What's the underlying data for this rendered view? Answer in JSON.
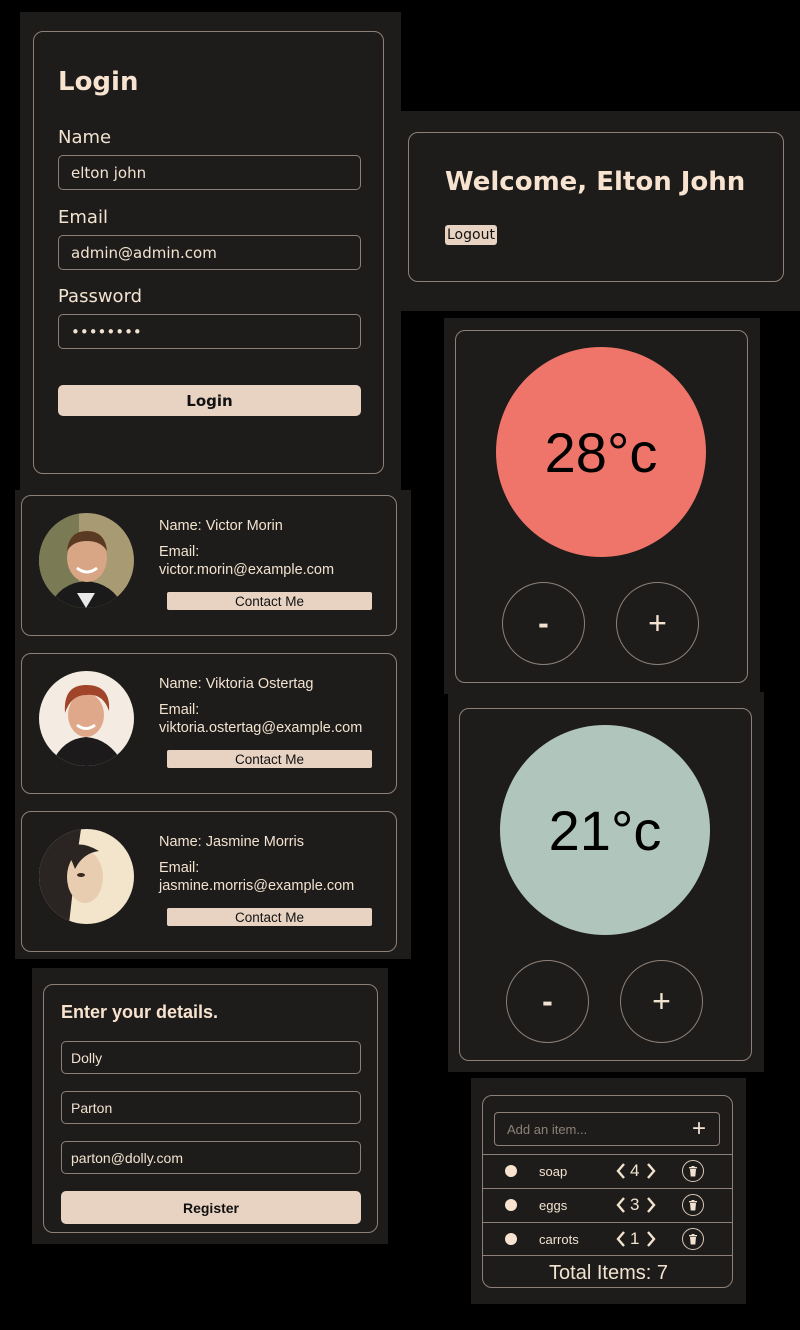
{
  "login": {
    "title": "Login",
    "name_label": "Name",
    "name_value": "elton john",
    "email_label": "Email",
    "email_value": "admin@admin.com",
    "password_label": "Password",
    "password_value": "password",
    "submit_label": "Login"
  },
  "welcome": {
    "title": "Welcome, Elton John",
    "logout_label": "Logout"
  },
  "thermostats": [
    {
      "value": "28°c",
      "color": "#ef746a",
      "minus_label": "-",
      "plus_label": "+"
    },
    {
      "value": "21°c",
      "color": "#b0c5bc",
      "minus_label": "-",
      "plus_label": "+"
    }
  ],
  "contacts": [
    {
      "name": "Name: Victor Morin",
      "email_label": "Email:",
      "email": "victor.morin@example.com",
      "button_label": "Contact Me"
    },
    {
      "name": "Name: Viktoria Ostertag",
      "email_label": "Email:",
      "email": "viktoria.ostertag@example.com",
      "button_label": "Contact Me"
    },
    {
      "name": "Name: Jasmine Morris",
      "email_label": "Email:",
      "email": "jasmine.morris@example.com",
      "button_label": "Contact Me"
    }
  ],
  "register": {
    "title": "Enter your details.",
    "first_name": "Dolly",
    "last_name": "Parton",
    "email": "parton@dolly.com",
    "submit_label": "Register"
  },
  "shopping_list": {
    "placeholder": "Add an item...",
    "add_label": "+",
    "items": [
      {
        "name": "soap",
        "quantity": "4"
      },
      {
        "name": "eggs",
        "quantity": "3"
      },
      {
        "name": "carrots",
        "quantity": "1"
      }
    ],
    "total": "Total Items: 7"
  },
  "colors": {
    "background": "#000000",
    "panel": "#1e1c1a",
    "border": "#8d8078",
    "text": "#f2e2d0",
    "button": "#e8d3c3"
  }
}
